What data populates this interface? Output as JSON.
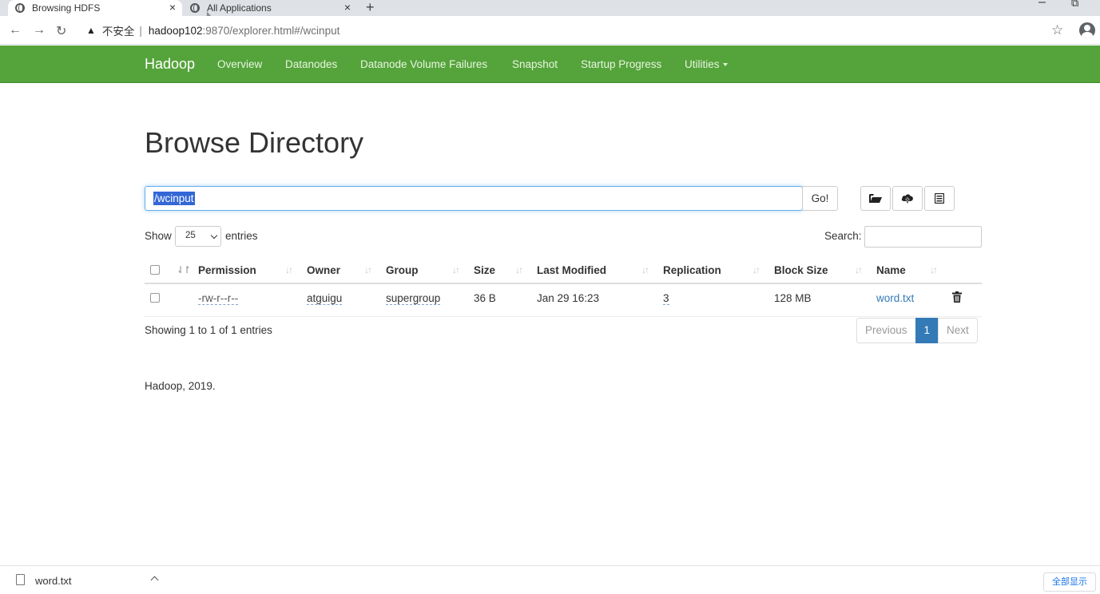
{
  "browser": {
    "tabs": [
      {
        "title": "Browsing HDFS",
        "active": true
      },
      {
        "title": "All Applications",
        "active": false
      }
    ],
    "new_tab": "+",
    "close_glyph": "×",
    "address": {
      "warning": "▲",
      "insecure_label": "不安全",
      "separator": "|",
      "host": "hadoop102",
      "path": ":9870/explorer.html#/wcinput"
    }
  },
  "navbar": {
    "brand": "Hadoop",
    "links": [
      "Overview",
      "Datanodes",
      "Datanode Volume Failures",
      "Snapshot",
      "Startup Progress",
      "Utilities"
    ],
    "color": "#55a33b"
  },
  "main": {
    "title": "Browse Directory",
    "path_value": "/wcinput",
    "go_label": "Go!",
    "tool_icons": [
      "folder-open-icon",
      "cloud-upload-icon",
      "list-icon"
    ],
    "show_label": "Show",
    "entries_value": "25",
    "entries_label": "entries",
    "search_label": "Search:",
    "columns": [
      "Permission",
      "Owner",
      "Group",
      "Size",
      "Last Modified",
      "Replication",
      "Block Size",
      "Name"
    ],
    "rows": [
      {
        "permission": "-rw-r--r--",
        "owner": "atguigu",
        "group": "supergroup",
        "size": "36 B",
        "last_modified": "Jan 29 16:23",
        "replication": "3",
        "block_size": "128 MB",
        "name": "word.txt"
      }
    ],
    "showing_text": "Showing 1 to 1 of 1 entries",
    "pagination": {
      "previous": "Previous",
      "current": "1",
      "next": "Next"
    },
    "footer": "Hadoop, 2019.",
    "link_color": "#337ab7"
  },
  "download_bar": {
    "file_name": "word.txt",
    "show_all": "全部显示"
  }
}
